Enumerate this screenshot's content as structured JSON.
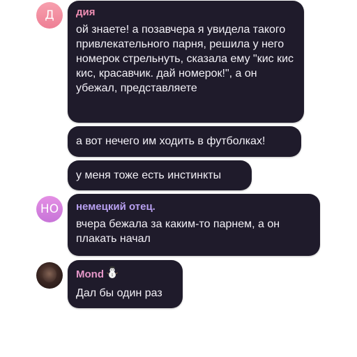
{
  "messages": [
    {
      "avatar_text": "Д",
      "sender": "дия",
      "text": "ой знаете! а позавчера я увидела такого привлекательного парня, решила у него номерок стрельнуть, сказала ему \"кис кис кис, красавчик. дай номерок!\", а он убежал, представляете"
    },
    {
      "text": "а вот нечего им ходить в футболках!"
    },
    {
      "text": "у меня тоже есть инстинкты"
    },
    {
      "avatar_text": "НО",
      "sender": "немецкий отец.",
      "text": "вчера бежала за каким-то парнем, а он плакать начал"
    },
    {
      "sender": "Mond",
      "sender_icon": "snowman-icon",
      "text": "Дал бы один раз"
    }
  ],
  "colors": {
    "bubble_bg": "#1f1b2b",
    "text": "#f3f1f7",
    "sender_pink": "#f08fb4",
    "sender_violet": "#b8a0f0",
    "sender_mond": "#e597c9",
    "avatar_pink": "#f08da0",
    "avatar_violet": "#d884e0"
  }
}
